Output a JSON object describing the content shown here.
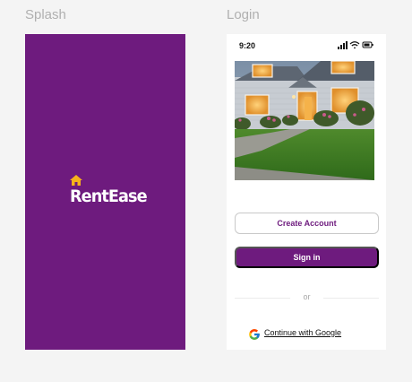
{
  "frames": {
    "splash_label": "Splash",
    "login_label": "Login"
  },
  "splash": {
    "brand_name": "RentEase",
    "background": "#6e1b7e",
    "logo_icon": "house-icon",
    "logo_icon_color": "#f6b21b"
  },
  "login": {
    "status": {
      "time": "9:20",
      "icons": [
        "signal-icon",
        "wifi-icon",
        "battery-icon"
      ]
    },
    "hero_image": "house-at-dusk",
    "create_account_label": "Create Account",
    "sign_in_label": "Sign in",
    "divider_text": "or",
    "google_label": "Continue with Google",
    "accent": "#6e1b7e"
  }
}
